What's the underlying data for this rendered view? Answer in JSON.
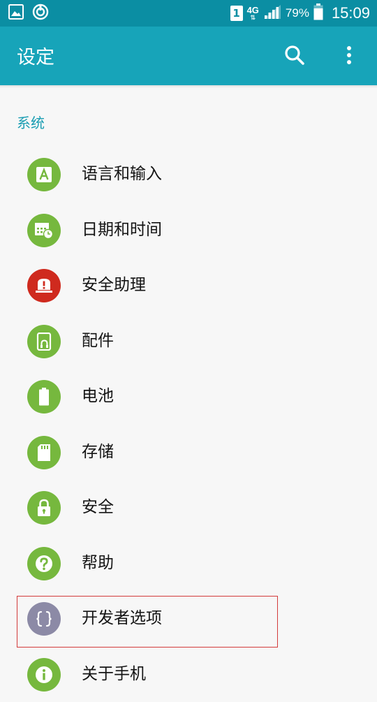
{
  "status_bar": {
    "sim_slot": "1",
    "network": "4G",
    "network_arrows": "⇅",
    "battery_percent": "79%",
    "time": "15:09"
  },
  "app_bar": {
    "title": "设定",
    "search_icon": "search-icon",
    "more_icon": "more-vert-icon"
  },
  "section": {
    "title": "系统"
  },
  "items": [
    {
      "label": "语言和输入",
      "icon": "language-icon",
      "color": "#76b83e"
    },
    {
      "label": "日期和时间",
      "icon": "calendar-clock-icon",
      "color": "#76b83e"
    },
    {
      "label": "安全助理",
      "icon": "alert-icon",
      "color": "#cf2a1e"
    },
    {
      "label": "配件",
      "icon": "accessory-icon",
      "color": "#76b83e"
    },
    {
      "label": "电池",
      "icon": "battery-icon",
      "color": "#76b83e"
    },
    {
      "label": "存储",
      "icon": "sd-card-icon",
      "color": "#76b83e"
    },
    {
      "label": "安全",
      "icon": "lock-icon",
      "color": "#76b83e"
    },
    {
      "label": "帮助",
      "icon": "help-icon",
      "color": "#76b83e"
    },
    {
      "label": "开发者选项",
      "icon": "braces-icon",
      "color": "#8c8aa6"
    },
    {
      "label": "关于手机",
      "icon": "info-icon",
      "color": "#76b83e"
    }
  ],
  "highlight": {
    "color": "#d33a3a",
    "target": "开发者选项"
  }
}
